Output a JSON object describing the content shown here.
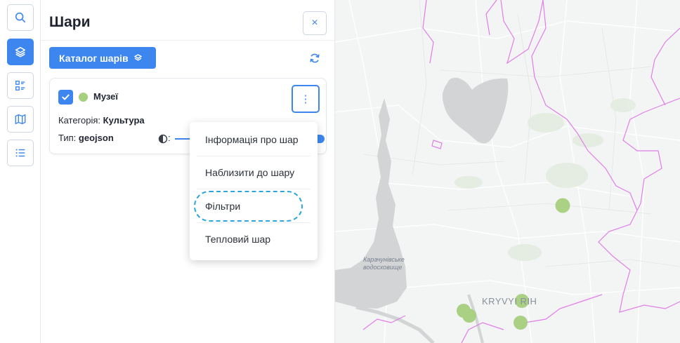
{
  "panel": {
    "title": "Шари",
    "close_icon": "×",
    "catalog_button": "Каталог шарів"
  },
  "rail": {
    "items": [
      {
        "icon": "search-icon"
      },
      {
        "icon": "layers-icon",
        "active": true
      },
      {
        "icon": "legend-icon"
      },
      {
        "icon": "map-icon"
      },
      {
        "icon": "list-icon"
      }
    ]
  },
  "layer": {
    "name": "Музеї",
    "color": "#a6cf7e",
    "category_label": "Категорія:",
    "category_value": "Культура",
    "type_label": "Тип:",
    "type_value": "geojson",
    "opacity_colon": ":",
    "menu_icon": "⋮"
  },
  "menu": {
    "items": [
      "Інформація про шар",
      "Наблизити до шару",
      "Фільтри",
      "Тепловий шар"
    ],
    "focused_index": 2
  },
  "map": {
    "reservoir_label_line1": "Карачунівське",
    "reservoir_label_line2": "водосховище",
    "city_label": "KRYVYI RIH",
    "accent": "#3d86f0",
    "boundary_color": "#e07ee8",
    "marker_color": "#a6cf7e"
  }
}
